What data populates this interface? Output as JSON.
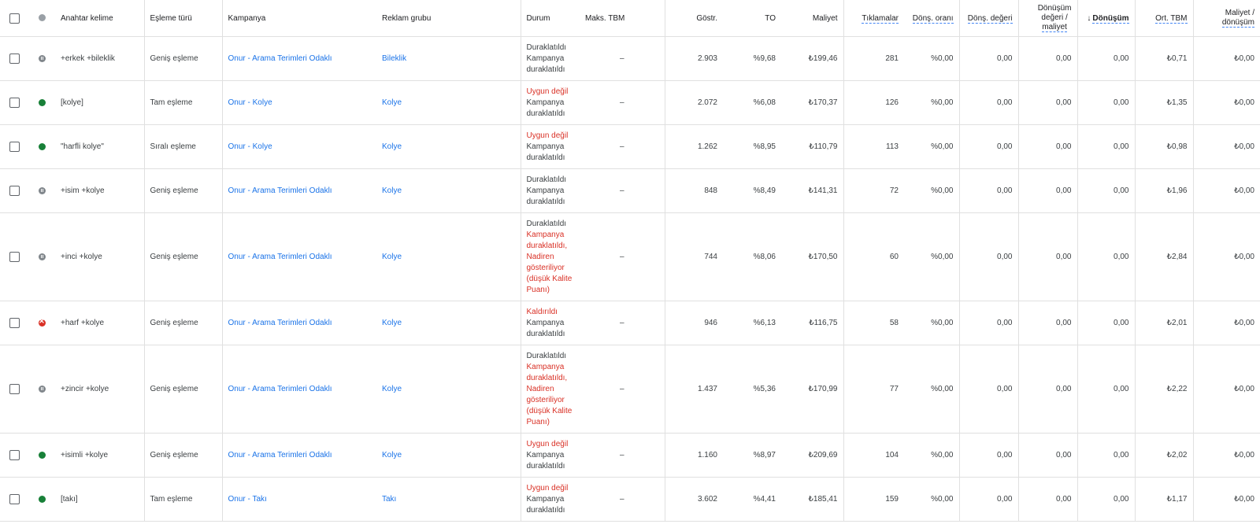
{
  "header": {
    "keyword": "Anahtar kelime",
    "match_type": "Eşleme türü",
    "campaign": "Kampanya",
    "ad_group": "Reklam grubu",
    "status": "Durum",
    "max_cpc": "Maks. TBM",
    "impressions": "Göstr.",
    "ctr": "TO",
    "cost": "Maliyet",
    "clicks": "Tıklamalar",
    "conv_rate": "Dönş. oranı",
    "conv_value": "Dönş. değeri",
    "conv_value_cost_1": "Dönüşüm",
    "conv_value_cost_2": "değeri /",
    "conv_value_cost_3": "maliyet",
    "sort_arrow": "↓",
    "conversions": "Dönüşüm",
    "avg_cpc": "Ort. TBM",
    "cost_per_conv_1": "Maliyet /",
    "cost_per_conv_2": "dönüşüm"
  },
  "rows": [
    {
      "status_icon": "paused-icon",
      "keyword": "+erkek +bileklik",
      "match": "Geniş eşleme",
      "campaign": "Onur - Arama Terimleri Odaklı",
      "adgroup": "Bileklik",
      "status_lines": [
        {
          "t": "Duraklatıldı",
          "red": false
        },
        {
          "t": "Kampanya",
          "red": false
        },
        {
          "t": "duraklatıldı",
          "red": false
        }
      ],
      "maxcpc": "–",
      "impr": "2.903",
      "ctr": "%9,68",
      "cost": "₺199,46",
      "clicks": "281",
      "convrate": "%0,00",
      "convval": "0,00",
      "valcost": "0,00",
      "conv": "0,00",
      "avgcpc": "₺0,71",
      "costconv": "₺0,00"
    },
    {
      "status_icon": "enabled-icon",
      "keyword": "[kolye]",
      "match": "Tam eşleme",
      "campaign": "Onur - Kolye",
      "adgroup": "Kolye",
      "status_lines": [
        {
          "t": "Uygun değil",
          "red": true
        },
        {
          "t": "Kampanya",
          "red": false
        },
        {
          "t": "duraklatıldı",
          "red": false
        }
      ],
      "maxcpc": "–",
      "impr": "2.072",
      "ctr": "%6,08",
      "cost": "₺170,37",
      "clicks": "126",
      "convrate": "%0,00",
      "convval": "0,00",
      "valcost": "0,00",
      "conv": "0,00",
      "avgcpc": "₺1,35",
      "costconv": "₺0,00"
    },
    {
      "status_icon": "enabled-icon",
      "keyword": "\"harfli kolye\"",
      "match": "Sıralı eşleme",
      "campaign": "Onur - Kolye",
      "adgroup": "Kolye",
      "status_lines": [
        {
          "t": "Uygun değil",
          "red": true
        },
        {
          "t": "Kampanya",
          "red": false
        },
        {
          "t": "duraklatıldı",
          "red": false
        }
      ],
      "maxcpc": "–",
      "impr": "1.262",
      "ctr": "%8,95",
      "cost": "₺110,79",
      "clicks": "113",
      "convrate": "%0,00",
      "convval": "0,00",
      "valcost": "0,00",
      "conv": "0,00",
      "avgcpc": "₺0,98",
      "costconv": "₺0,00"
    },
    {
      "status_icon": "paused-icon",
      "keyword": "+isim +kolye",
      "match": "Geniş eşleme",
      "campaign": "Onur - Arama Terimleri Odaklı",
      "adgroup": "Kolye",
      "status_lines": [
        {
          "t": "Duraklatıldı",
          "red": false
        },
        {
          "t": "Kampanya",
          "red": false
        },
        {
          "t": "duraklatıldı",
          "red": false
        }
      ],
      "maxcpc": "–",
      "impr": "848",
      "ctr": "%8,49",
      "cost": "₺141,31",
      "clicks": "72",
      "convrate": "%0,00",
      "convval": "0,00",
      "valcost": "0,00",
      "conv": "0,00",
      "avgcpc": "₺1,96",
      "costconv": "₺0,00"
    },
    {
      "status_icon": "paused-icon",
      "keyword": "+inci +kolye",
      "match": "Geniş eşleme",
      "campaign": "Onur - Arama Terimleri Odaklı",
      "adgroup": "Kolye",
      "status_lines": [
        {
          "t": "Duraklatıldı",
          "red": false
        },
        {
          "t": "Kampanya",
          "red": true
        },
        {
          "t": "duraklatıldı,",
          "red": true
        },
        {
          "t": "Nadiren",
          "red": true
        },
        {
          "t": "gösteriliyor",
          "red": true
        },
        {
          "t": "(düşük Kalite",
          "red": true
        },
        {
          "t": "Puanı)",
          "red": true
        }
      ],
      "maxcpc": "–",
      "impr": "744",
      "ctr": "%8,06",
      "cost": "₺170,50",
      "clicks": "60",
      "convrate": "%0,00",
      "convval": "0,00",
      "valcost": "0,00",
      "conv": "0,00",
      "avgcpc": "₺2,84",
      "costconv": "₺0,00"
    },
    {
      "status_icon": "removed-icon",
      "keyword": "+harf +kolye",
      "match": "Geniş eşleme",
      "campaign": "Onur - Arama Terimleri Odaklı",
      "adgroup": "Kolye",
      "status_lines": [
        {
          "t": "Kaldırıldı",
          "red": true
        },
        {
          "t": "Kampanya",
          "red": false
        },
        {
          "t": "duraklatıldı",
          "red": false
        }
      ],
      "maxcpc": "–",
      "impr": "946",
      "ctr": "%6,13",
      "cost": "₺116,75",
      "clicks": "58",
      "convrate": "%0,00",
      "convval": "0,00",
      "valcost": "0,00",
      "conv": "0,00",
      "avgcpc": "₺2,01",
      "costconv": "₺0,00"
    },
    {
      "status_icon": "paused-icon",
      "keyword": "+zincir +kolye",
      "match": "Geniş eşleme",
      "campaign": "Onur - Arama Terimleri Odaklı",
      "adgroup": "Kolye",
      "status_lines": [
        {
          "t": "Duraklatıldı",
          "red": false
        },
        {
          "t": "Kampanya",
          "red": true
        },
        {
          "t": "duraklatıldı,",
          "red": true
        },
        {
          "t": "Nadiren",
          "red": true
        },
        {
          "t": "gösteriliyor",
          "red": true
        },
        {
          "t": "(düşük Kalite",
          "red": true
        },
        {
          "t": "Puanı)",
          "red": true
        }
      ],
      "maxcpc": "–",
      "impr": "1.437",
      "ctr": "%5,36",
      "cost": "₺170,99",
      "clicks": "77",
      "convrate": "%0,00",
      "convval": "0,00",
      "valcost": "0,00",
      "conv": "0,00",
      "avgcpc": "₺2,22",
      "costconv": "₺0,00"
    },
    {
      "status_icon": "enabled-icon",
      "keyword": "+isimli +kolye",
      "match": "Geniş eşleme",
      "campaign": "Onur - Arama Terimleri Odaklı",
      "adgroup": "Kolye",
      "status_lines": [
        {
          "t": "Uygun değil",
          "red": true
        },
        {
          "t": "Kampanya",
          "red": false
        },
        {
          "t": "duraklatıldı",
          "red": false
        }
      ],
      "maxcpc": "–",
      "impr": "1.160",
      "ctr": "%8,97",
      "cost": "₺209,69",
      "clicks": "104",
      "convrate": "%0,00",
      "convval": "0,00",
      "valcost": "0,00",
      "conv": "0,00",
      "avgcpc": "₺2,02",
      "costconv": "₺0,00"
    },
    {
      "status_icon": "enabled-icon",
      "keyword": "[takı]",
      "match": "Tam eşleme",
      "campaign": "Onur - Takı",
      "adgroup": "Takı",
      "status_lines": [
        {
          "t": "Uygun değil",
          "red": true
        },
        {
          "t": "Kampanya",
          "red": false
        },
        {
          "t": "duraklatıldı",
          "red": false
        }
      ],
      "maxcpc": "–",
      "impr": "3.602",
      "ctr": "%4,41",
      "cost": "₺185,41",
      "clicks": "159",
      "convrate": "%0,00",
      "convval": "0,00",
      "valcost": "0,00",
      "conv": "0,00",
      "avgcpc": "₺1,17",
      "costconv": "₺0,00"
    }
  ]
}
